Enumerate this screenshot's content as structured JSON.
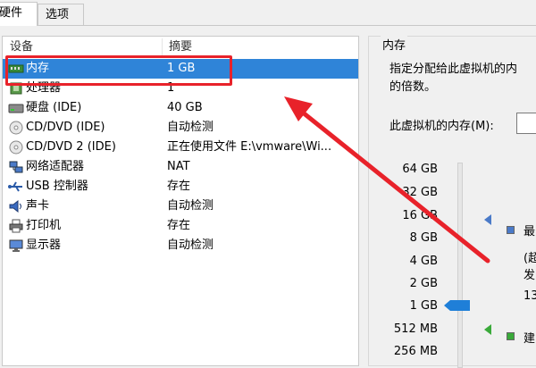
{
  "tabs": [
    {
      "label": "硬件",
      "active": true
    },
    {
      "label": "选项",
      "active": false
    }
  ],
  "device_list": {
    "headers": {
      "device": "设备",
      "summary": "摘要"
    },
    "rows": [
      {
        "icon": "memory-icon",
        "name": "内存",
        "summary": "1 GB",
        "selected": true
      },
      {
        "icon": "cpu-icon",
        "name": "处理器",
        "summary": "1"
      },
      {
        "icon": "hard-disk-icon",
        "name": "硬盘 (IDE)",
        "summary": "40 GB"
      },
      {
        "icon": "cd-dvd-icon",
        "name": "CD/DVD (IDE)",
        "summary": "自动检测"
      },
      {
        "icon": "cd-dvd-icon",
        "name": "CD/DVD 2 (IDE)",
        "summary": "正在使用文件 E:\\vmware\\Wi..."
      },
      {
        "icon": "network-adapter-icon",
        "name": "网络适配器",
        "summary": "NAT"
      },
      {
        "icon": "usb-icon",
        "name": "USB 控制器",
        "summary": "存在"
      },
      {
        "icon": "sound-card-icon",
        "name": "声卡",
        "summary": "自动检测"
      },
      {
        "icon": "printer-icon",
        "name": "打印机",
        "summary": "存在"
      },
      {
        "icon": "display-icon",
        "name": "显示器",
        "summary": "自动检测"
      }
    ]
  },
  "memory": {
    "group_title": "内存",
    "description_line1": "指定分配给此虚拟机的内",
    "description_line2": "的倍数。",
    "vm_memory_label": "此虚拟机的内存(M):",
    "scale_labels": [
      "64 GB",
      "32 GB",
      "16 GB",
      "8 GB",
      "4 GB",
      "2 GB",
      "1 GB",
      "512 MB",
      "256 MB"
    ],
    "selected_value": "1 GB",
    "max_label": "最",
    "note_line1": "(超",
    "note_line2": "发",
    "value_13": "13",
    "recommended_label": "建"
  },
  "colors": {
    "selection": "#2f84d8",
    "annotation_red": "#e8222a",
    "slider_thumb": "#1f7fd8"
  }
}
